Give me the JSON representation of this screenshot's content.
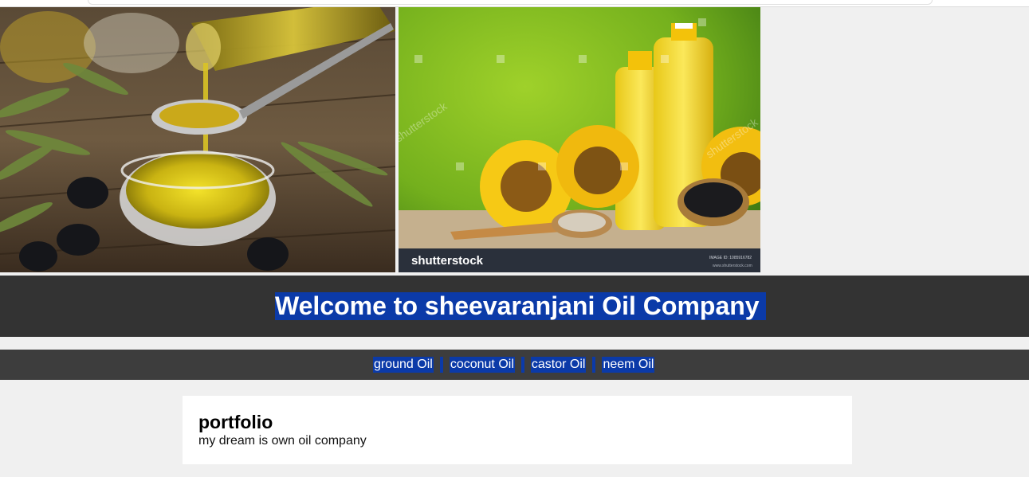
{
  "header": {
    "title": "Welcome to sheevaranjani Oil Company"
  },
  "nav": {
    "items": [
      {
        "label": "ground Oil"
      },
      {
        "label": "coconut Oil"
      },
      {
        "label": "castor Oil"
      },
      {
        "label": "neem Oil"
      }
    ]
  },
  "portfolio": {
    "heading": "portfolio",
    "text": "my dream is own oil company"
  },
  "images": {
    "sunflower": {
      "watermark": "shutterstock",
      "watermark_small": "shutterstock",
      "image_id": "IMAGE ID: 1085916782",
      "site": "www.shutterstock.com"
    }
  },
  "colors": {
    "highlight": "#0b3aa8",
    "header_bg": "#333333",
    "nav_bg": "#3d3d3d",
    "page_bg": "#f0f0f0"
  }
}
